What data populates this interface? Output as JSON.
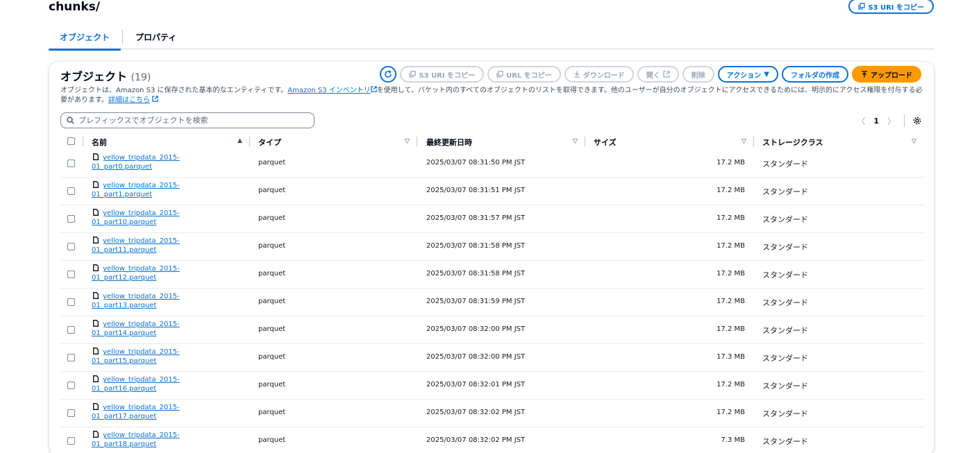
{
  "header": {
    "folder_title": "chunks/",
    "copy_s3_uri_label": "S3 URI をコピー"
  },
  "tabs": [
    {
      "label": "オブジェクト",
      "active": true
    },
    {
      "label": "プロパティ",
      "active": false
    }
  ],
  "panel": {
    "title": "オブジェクト",
    "count": "(19)",
    "toolbar": {
      "copy_s3_uri": "S3 URI をコピー",
      "copy_url": "URL をコピー",
      "download": "ダウンロード",
      "open": "開く",
      "delete": "削除",
      "actions": "アクション",
      "create_folder": "フォルダの作成",
      "upload": "アップロード"
    },
    "description": {
      "part1": "オブジェクトは、Amazon S3 に保存された基本的なエンティティです。",
      "link1": "Amazon S3 インベントリ",
      "part2": "を使用して、バケット内のすべてのオブジェクトのリストを取得できます。他のユーザーが自分のオブジェクトにアクセスできるためには、明示的にアクセス権限を付与する必要があります。",
      "link2": "詳細はこちら"
    },
    "search": {
      "placeholder": "プレフィックスでオブジェクトを検索",
      "value": ""
    },
    "pagination": {
      "current_page": "1"
    },
    "columns": {
      "name": "名前",
      "type": "タイプ",
      "modified": "最終更新日時",
      "size": "サイズ",
      "storage_class": "ストレージクラス"
    },
    "rows": [
      {
        "name_line1": "yellow_tripdata_2015-",
        "name_line2": "01_part0.parquet",
        "type": "parquet",
        "modified": "2025/03/07 08:31:50 PM JST",
        "size": "17.2 MB",
        "storage": "スタンダード"
      },
      {
        "name_line1": "yellow_tripdata_2015-",
        "name_line2": "01_part1.parquet",
        "type": "parquet",
        "modified": "2025/03/07 08:31:51 PM JST",
        "size": "17.2 MB",
        "storage": "スタンダード"
      },
      {
        "name_line1": "yellow_tripdata_2015-",
        "name_line2": "01_part10.parquet",
        "type": "parquet",
        "modified": "2025/03/07 08:31:57 PM JST",
        "size": "17.2 MB",
        "storage": "スタンダード"
      },
      {
        "name_line1": "yellow_tripdata_2015-",
        "name_line2": "01_part11.parquet",
        "type": "parquet",
        "modified": "2025/03/07 08:31:58 PM JST",
        "size": "17.2 MB",
        "storage": "スタンダード"
      },
      {
        "name_line1": "yellow_tripdata_2015-",
        "name_line2": "01_part12.parquet",
        "type": "parquet",
        "modified": "2025/03/07 08:31:58 PM JST",
        "size": "17.2 MB",
        "storage": "スタンダード"
      },
      {
        "name_line1": "yellow_tripdata_2015-",
        "name_line2": "01_part13.parquet",
        "type": "parquet",
        "modified": "2025/03/07 08:31:59 PM JST",
        "size": "17.2 MB",
        "storage": "スタンダード"
      },
      {
        "name_line1": "yellow_tripdata_2015-",
        "name_line2": "01_part14.parquet",
        "type": "parquet",
        "modified": "2025/03/07 08:32:00 PM JST",
        "size": "17.2 MB",
        "storage": "スタンダード"
      },
      {
        "name_line1": "yellow_tripdata_2015-",
        "name_line2": "01_part15.parquet",
        "type": "parquet",
        "modified": "2025/03/07 08:32:00 PM JST",
        "size": "17.3 MB",
        "storage": "スタンダード"
      },
      {
        "name_line1": "yellow_tripdata_2015-",
        "name_line2": "01_part16.parquet",
        "type": "parquet",
        "modified": "2025/03/07 08:32:01 PM JST",
        "size": "17.2 MB",
        "storage": "スタンダード"
      },
      {
        "name_line1": "yellow_tripdata_2015-",
        "name_line2": "01_part17.parquet",
        "type": "parquet",
        "modified": "2025/03/07 08:32:02 PM JST",
        "size": "17.2 MB",
        "storage": "スタンダード"
      },
      {
        "name_line1": "yellow_tripdata_2015-",
        "name_line2": "01_part18.parquet",
        "type": "parquet",
        "modified": "2025/03/07 08:32:02 PM JST",
        "size": "7.3 MB",
        "storage": "スタンダード"
      }
    ]
  },
  "colors": {
    "link": "#0972d3",
    "primary": "#ff9900",
    "border": "#e9ebed"
  }
}
